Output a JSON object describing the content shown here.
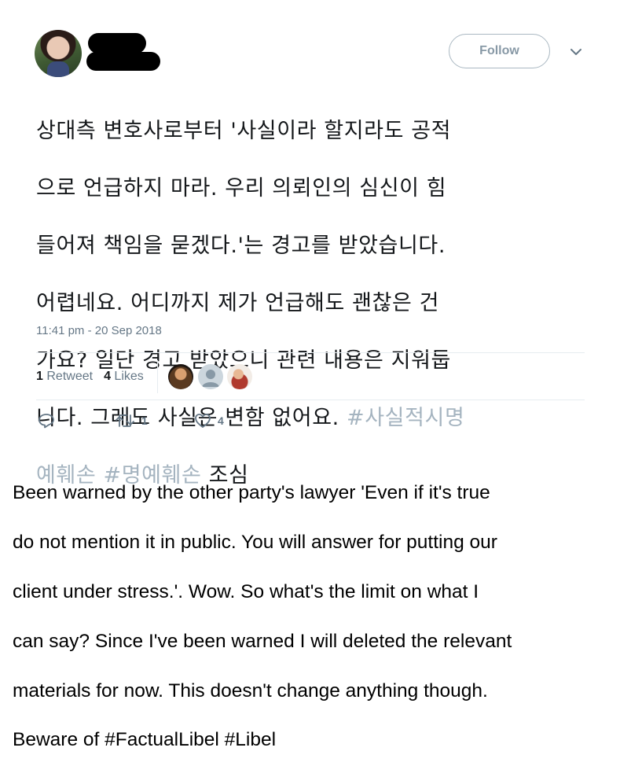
{
  "header": {
    "follow_label": "Follow",
    "chevron_icon": "chevron-down-icon"
  },
  "tweet": {
    "text_lines": [
      "상대측 변호사로부터 '사실이라 할지라도 공적",
      "으로 언급하지 마라. 우리 의뢰인의 심신이 힘",
      "들어져 책임을 묻겠다.'는 경고를 받았습니다.",
      "어렵네요. 어디까지 제가 언급해도 괜찮은 건",
      "가요? 일단 경고 받았으니 관련 내용은 지워둡",
      "니다. 그래도 사실은 변함 없어요. "
    ],
    "hashtag1_part1": "#사실적시명",
    "hashtag1_part2": "예훼손",
    "space": " ",
    "hashtag2": "#명예훼손",
    "trailing": " 조심",
    "timestamp": "11:41 pm - 20 Sep 2018"
  },
  "stats": {
    "retweet_count": "1",
    "retweet_label": "Retweet",
    "like_count": "4",
    "like_label": "Likes"
  },
  "actions": {
    "reply_icon": "reply-icon",
    "retweet_icon": "retweet-icon",
    "retweet_count": "1",
    "like_icon": "heart-icon",
    "like_count": "4"
  },
  "translation": {
    "lines": [
      "Been warned by the other party's lawyer 'Even if it's true",
      "do not mention it in public. You will answer for putting our",
      "client under stress.'. Wow. So what's the limit on what I",
      "can say? Since I've been warned I will deleted the relevant",
      "materials for now. This doesn't change anything though.",
      "Beware of #FactualLibel #Libel"
    ]
  },
  "colors": {
    "hashtag": "#a5b4c0",
    "muted": "#657786",
    "text": "#14171a",
    "border": "#e6ecf0"
  }
}
